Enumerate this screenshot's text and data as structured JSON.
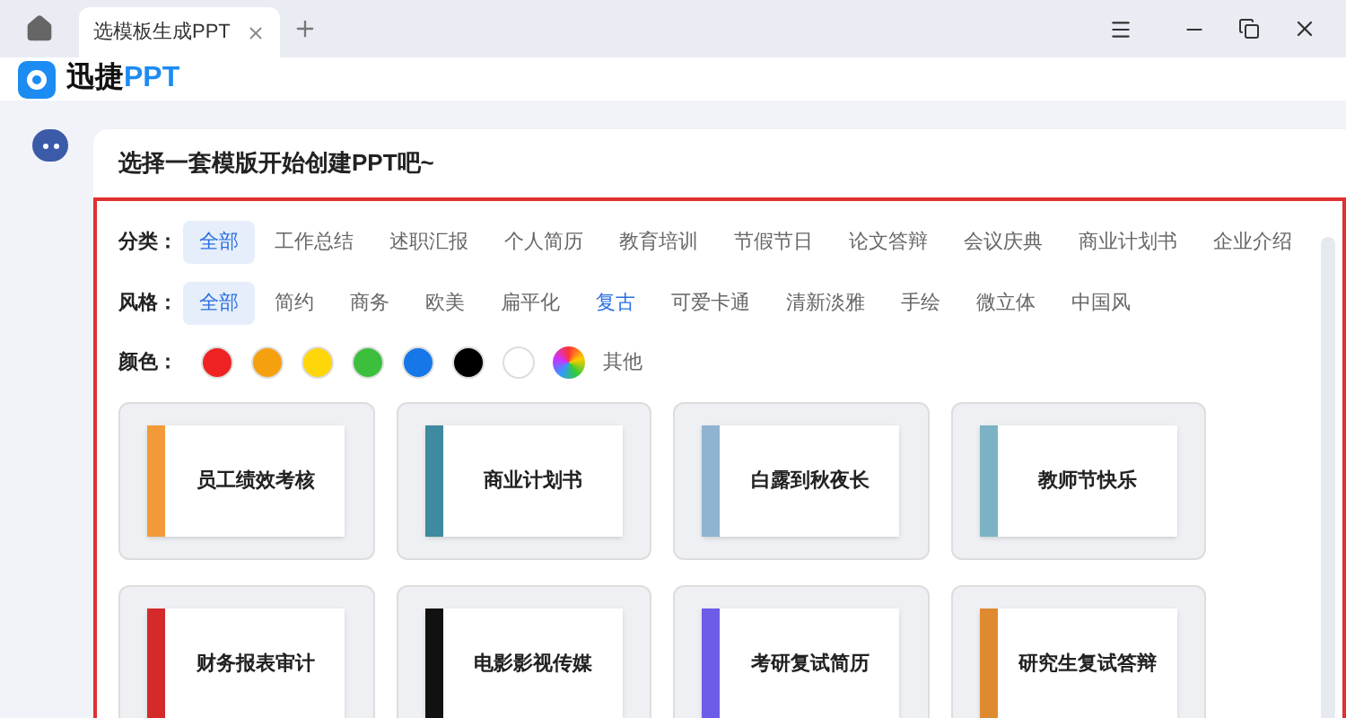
{
  "tabs": [
    {
      "label": "选模板生成PPT",
      "selected": true
    }
  ],
  "app": {
    "name_prefix": "迅捷",
    "name_suffix": "PPT"
  },
  "prompt": "选择一套模版开始创建PPT吧~",
  "filters": [
    {
      "label": "分类：",
      "options": [
        {
          "label": "全部",
          "selected": true,
          "hovered": false
        },
        {
          "label": "工作总结",
          "selected": false,
          "hovered": false
        },
        {
          "label": "述职汇报",
          "selected": false,
          "hovered": false
        },
        {
          "label": "个人简历",
          "selected": false,
          "hovered": false
        },
        {
          "label": "教育培训",
          "selected": false,
          "hovered": false
        },
        {
          "label": "节假节日",
          "selected": false,
          "hovered": false
        },
        {
          "label": "论文答辩",
          "selected": false,
          "hovered": false
        },
        {
          "label": "会议庆典",
          "selected": false,
          "hovered": false
        },
        {
          "label": "商业计划书",
          "selected": false,
          "hovered": false
        },
        {
          "label": "企业介绍",
          "selected": false,
          "hovered": false
        }
      ]
    },
    {
      "label": "风格：",
      "options": [
        {
          "label": "全部",
          "selected": true,
          "hovered": false
        },
        {
          "label": "简约",
          "selected": false,
          "hovered": false
        },
        {
          "label": "商务",
          "selected": false,
          "hovered": false
        },
        {
          "label": "欧美",
          "selected": false,
          "hovered": false
        },
        {
          "label": "扁平化",
          "selected": false,
          "hovered": false
        },
        {
          "label": "复古",
          "selected": false,
          "hovered": true
        },
        {
          "label": "可爱卡通",
          "selected": false,
          "hovered": false
        },
        {
          "label": "清新淡雅",
          "selected": false,
          "hovered": false
        },
        {
          "label": "手绘",
          "selected": false,
          "hovered": false
        },
        {
          "label": "微立体",
          "selected": false,
          "hovered": false
        },
        {
          "label": "中国风",
          "selected": false,
          "hovered": false
        }
      ]
    }
  ],
  "colors": {
    "label": "颜色：",
    "swatches": [
      {
        "kind": "solid",
        "color": "#ee2222",
        "selected": false
      },
      {
        "kind": "solid",
        "color": "#f5a00f",
        "selected": false
      },
      {
        "kind": "solid",
        "color": "#ffd60a",
        "selected": false
      },
      {
        "kind": "solid",
        "color": "#3cbf3c",
        "selected": false
      },
      {
        "kind": "solid",
        "color": "#1677e8",
        "selected": false
      },
      {
        "kind": "solid",
        "color": "#000000",
        "selected": false
      },
      {
        "kind": "solid",
        "color": "#ffffff",
        "selected": false
      },
      {
        "kind": "rainbow",
        "selected": false
      }
    ],
    "other": "其他"
  },
  "templates": [
    {
      "title": "员工绩效考核",
      "color": "#f29a3a"
    },
    {
      "title": "商业计划书",
      "color": "#3e8a9e"
    },
    {
      "title": "白露到秋夜长",
      "color": "#8fb3d0"
    },
    {
      "title": "教师节快乐",
      "color": "#7bb3c4"
    },
    {
      "title": "财务报表审计",
      "color": "#d42a2a"
    },
    {
      "title": "电影影视传媒",
      "color": "#111111"
    },
    {
      "title": "考研复试简历",
      "color": "#6c5ce7"
    },
    {
      "title": "研究生复试答辩",
      "color": "#e08a30"
    }
  ]
}
